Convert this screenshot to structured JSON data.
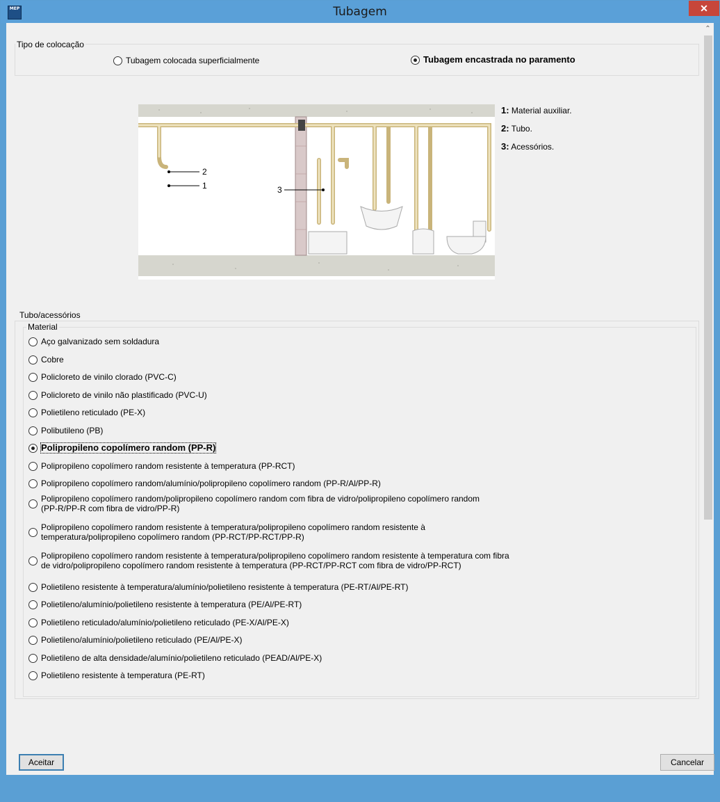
{
  "window": {
    "title": "Tubagem",
    "icon_text": "MEP"
  },
  "placement": {
    "legend": "Tipo de colocação",
    "options": [
      {
        "label": "Tubagem colocada superficialmente",
        "selected": false
      },
      {
        "label": "Tubagem encastrada no paramento",
        "selected": true
      }
    ]
  },
  "diagram": {
    "callouts": [
      "2",
      "1",
      "3"
    ],
    "legend": [
      {
        "num": "1:",
        "text": "Material auxiliar."
      },
      {
        "num": "2:",
        "text": "Tubo."
      },
      {
        "num": "3:",
        "text": "Acessórios."
      }
    ]
  },
  "tube": {
    "legend": "Tubo/acessórios",
    "material_legend": "Material",
    "materials": [
      {
        "line1": "Aço galvanizado sem soldadura",
        "line2": "",
        "selected": false
      },
      {
        "line1": "Cobre",
        "line2": "",
        "selected": false
      },
      {
        "line1": "Policloreto de vinilo clorado (PVC-C)",
        "line2": "",
        "selected": false
      },
      {
        "line1": "Policloreto de vinilo não plastificado (PVC-U)",
        "line2": "",
        "selected": false
      },
      {
        "line1": "Polietileno reticulado (PE-X)",
        "line2": "",
        "selected": false
      },
      {
        "line1": "Polibutileno (PB)",
        "line2": "",
        "selected": false
      },
      {
        "line1": "Polipropileno copolímero random (PP-R)",
        "line2": "",
        "selected": true
      },
      {
        "line1": "Polipropileno copolímero random resistente à temperatura (PP-RCT)",
        "line2": "",
        "selected": false
      },
      {
        "line1": "Polipropileno copolímero random/alumínio/polipropileno copolímero random (PP-R/Al/PP-R)",
        "line2": "",
        "selected": false
      },
      {
        "line1": "Polipropileno copolímero random/polipropileno copolímero random com fibra de vidro/polipropileno copolímero random",
        "line2": "(PP-R/PP-R com fibra de vidro/PP-R)",
        "selected": false
      },
      {
        "line1": "Polipropileno copolímero random resistente à temperatura/polipropileno copolímero random resistente à",
        "line2": "temperatura/polipropileno copolímero random (PP-RCT/PP-RCT/PP-R)",
        "selected": false
      },
      {
        "line1": "Polipropileno copolímero random resistente à temperatura/polipropileno copolímero random resistente à temperatura com fibra",
        "line2": "de vidro/polipropileno copolímero random resistente à temperatura (PP-RCT/PP-RCT com fibra de vidro/PP-RCT)",
        "selected": false
      },
      {
        "line1": "Polietileno resistente à temperatura/alumínio/polietileno resistente à temperatura (PE-RT/Al/PE-RT)",
        "line2": "",
        "selected": false
      },
      {
        "line1": "Polietileno/alumínio/polietileno resistente à temperatura (PE/Al/PE-RT)",
        "line2": "",
        "selected": false
      },
      {
        "line1": "Polietileno reticulado/alumínio/polietileno reticulado (PE-X/Al/PE-X)",
        "line2": "",
        "selected": false
      },
      {
        "line1": "Polietileno/alumínio/polietileno reticulado (PE/Al/PE-X)",
        "line2": "",
        "selected": false
      },
      {
        "line1": "Polietileno de alta densidade/alumínio/polietileno reticulado (PEAD/Al/PE-X)",
        "line2": "",
        "selected": false
      },
      {
        "line1": "Polietileno resistente à temperatura (PE-RT)",
        "line2": "",
        "selected": false
      }
    ]
  },
  "buttons": {
    "accept": "Aceitar",
    "cancel": "Cancelar"
  },
  "colors": {
    "titlebar": "#5aa0d8",
    "close": "#c7463a",
    "pipe": "#e8d8a6",
    "wall": "#d0d0c8"
  }
}
